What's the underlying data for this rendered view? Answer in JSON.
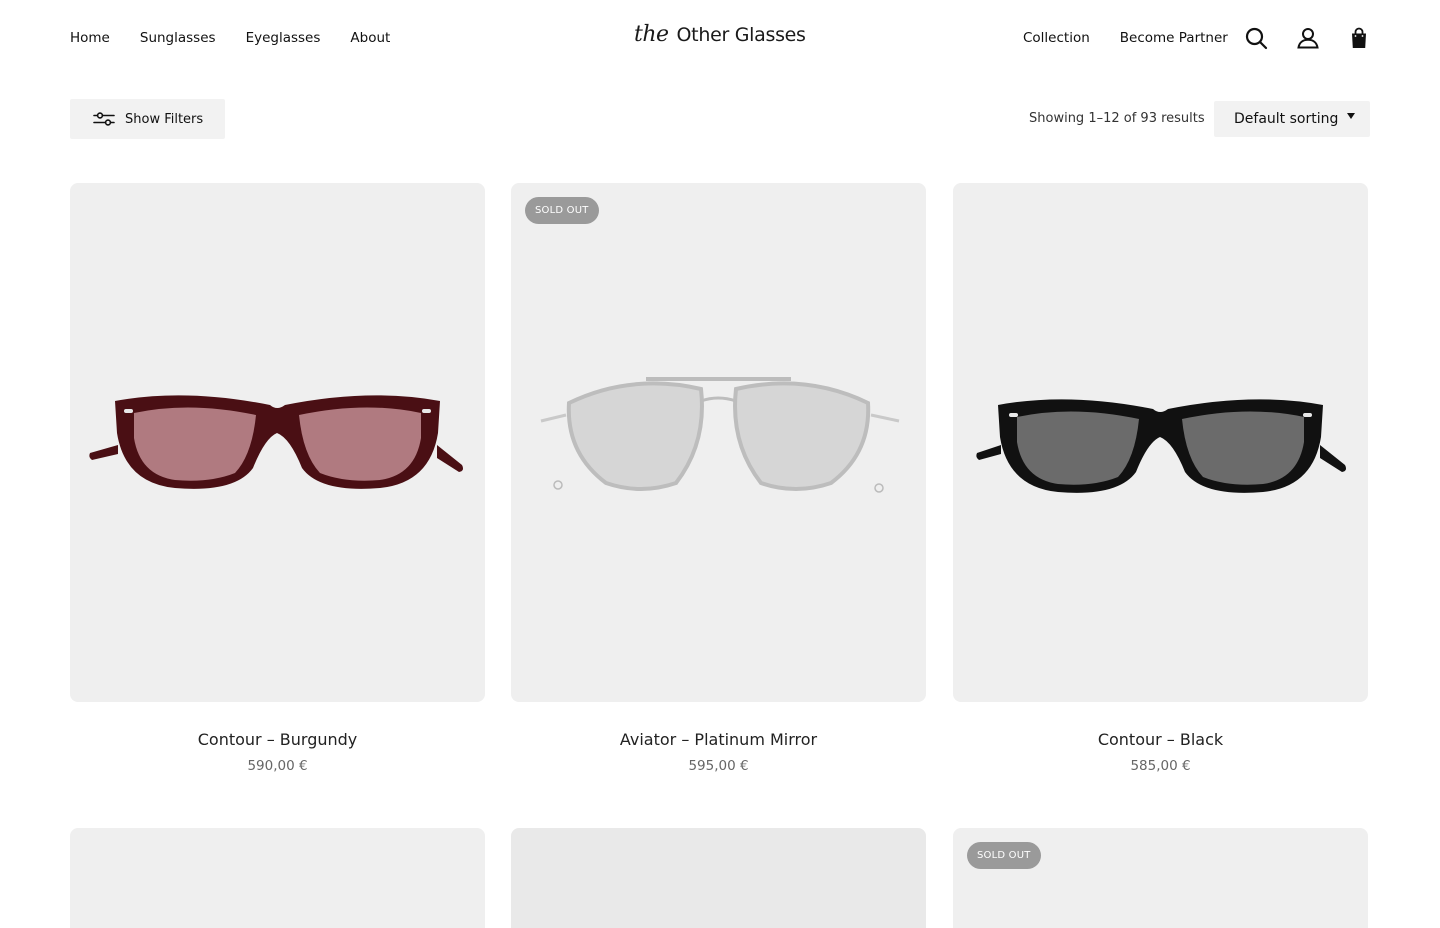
{
  "header": {
    "nav_left": [
      "Home",
      "Sunglasses",
      "Eyeglasses",
      "About"
    ],
    "logo": {
      "prefix": "the",
      "name": "Other Glasses"
    },
    "nav_right": [
      "Collection",
      "Become Partner"
    ],
    "icons": [
      "search-icon",
      "account-icon",
      "shopping-bag-icon"
    ]
  },
  "toolbar": {
    "filters_label": "Show Filters",
    "result_count": "Showing 1–12 of 93 results",
    "sort_label": "Default sorting"
  },
  "colors": {
    "card_bg": "#efefef",
    "badge_bg": "#9a9a9a",
    "button_bg": "#f2f2f2"
  },
  "products": [
    {
      "title": "Contour – Burgundy",
      "price": "590,00 €",
      "badge": "",
      "frame_color": "#4a0f14",
      "lens_color": "#b07a80"
    },
    {
      "title": "Aviator – Platinum Mirror",
      "price": "595,00 €",
      "badge": "SOLD OUT",
      "frame_color": "#c9c9c9",
      "lens_color": "#d6d6d6"
    },
    {
      "title": "Contour – Black",
      "price": "585,00 €",
      "badge": "",
      "frame_color": "#111111",
      "lens_color": "#6b6b6b"
    },
    {
      "title": "",
      "price": "",
      "badge": ""
    },
    {
      "title": "",
      "price": "",
      "badge": ""
    },
    {
      "title": "",
      "price": "",
      "badge": "SOLD OUT"
    }
  ]
}
